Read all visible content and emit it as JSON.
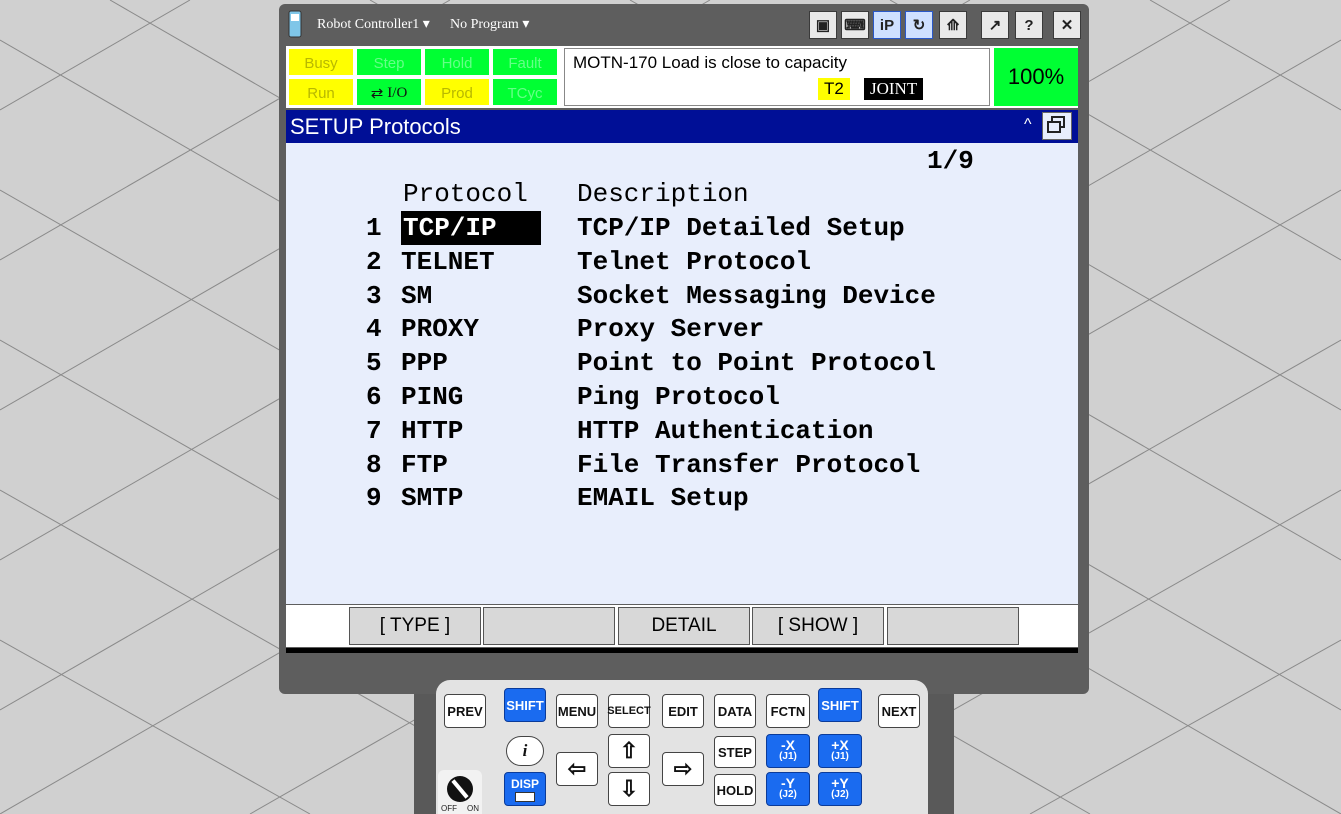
{
  "titlebar": {
    "controller": "Robot Controller1",
    "program": "No Program",
    "buttons": [
      {
        "name": "teach-pendant-icon",
        "glyph": "▣"
      },
      {
        "name": "keyboard-icon",
        "glyph": "⌨"
      },
      {
        "name": "ip-icon",
        "glyph": "iP"
      },
      {
        "name": "refresh-icon",
        "glyph": "↻"
      },
      {
        "name": "robot-icon",
        "glyph": "⟰"
      },
      {
        "name": "external-link-icon",
        "glyph": "↗"
      },
      {
        "name": "help-icon",
        "glyph": "?"
      },
      {
        "name": "close-icon",
        "glyph": "✕"
      }
    ]
  },
  "status": {
    "leds_top": [
      "Busy",
      "Step",
      "Hold",
      "Fault"
    ],
    "leds_bottom": [
      "Run",
      "I/O",
      "Prod",
      "TCyc"
    ],
    "message": "MOTN-170 Load is close to capacity",
    "mode": "T2",
    "coord": "JOINT",
    "override": "100%"
  },
  "screen": {
    "title": "SETUP Protocols",
    "page": "1/9",
    "col_protocol": "Protocol",
    "col_description": "Description",
    "rows": [
      {
        "num": "1",
        "protocol": "TCP/IP",
        "description": "TCP/IP Detailed Setup"
      },
      {
        "num": "2",
        "protocol": "TELNET",
        "description": "Telnet Protocol"
      },
      {
        "num": "3",
        "protocol": "SM",
        "description": "Socket Messaging Device"
      },
      {
        "num": "4",
        "protocol": "PROXY",
        "description": "Proxy Server"
      },
      {
        "num": "5",
        "protocol": "PPP",
        "description": "Point to Point Protocol"
      },
      {
        "num": "6",
        "protocol": "PING",
        "description": "Ping Protocol"
      },
      {
        "num": "7",
        "protocol": "HTTP",
        "description": "HTTP Authentication"
      },
      {
        "num": "8",
        "protocol": "FTP",
        "description": "File Transfer Protocol"
      },
      {
        "num": "9",
        "protocol": "SMTP",
        "description": "EMAIL Setup"
      }
    ]
  },
  "fkeys": [
    "[ TYPE ]",
    "",
    "DETAIL",
    "[ SHOW ]",
    ""
  ],
  "keypad": {
    "prev": "PREV",
    "shift": "SHIFT",
    "menu": "MENU",
    "select": "SELECT",
    "edit": "EDIT",
    "data": "DATA",
    "fctn": "FCTN",
    "next": "NEXT",
    "info": "i",
    "disp": "DISP",
    "step": "STEP",
    "hold": "HOLD",
    "minus_x": "-X",
    "plus_x": "+X",
    "j1": "(J1)",
    "minus_y": "-Y",
    "plus_y": "+Y",
    "j2": "(J2)",
    "off": "OFF",
    "on": "ON"
  }
}
